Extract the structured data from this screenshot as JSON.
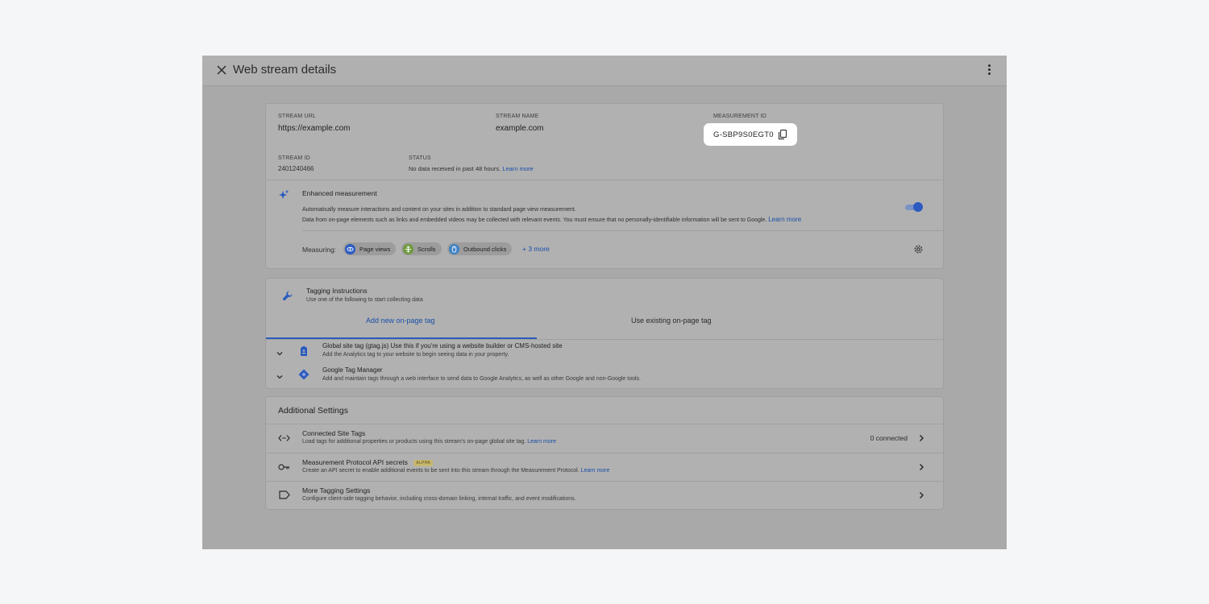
{
  "header": {
    "title": "Web stream details"
  },
  "details": {
    "stream_url_label": "STREAM URL",
    "stream_url": "https://example.com",
    "stream_name_label": "STREAM NAME",
    "stream_name": "example.com",
    "measurement_id_label": "MEASUREMENT ID",
    "measurement_id": "G-SBP9S0EGT0",
    "stream_id_label": "STREAM ID",
    "stream_id": "2401240466",
    "status_label": "STATUS",
    "status_text": "No data received in past 48 hours.",
    "status_link": "Learn more"
  },
  "enhanced": {
    "title": "Enhanced measurement",
    "desc_1": "Automatically measure interactions and content on your sites in addition to standard page view measurement.",
    "desc_2": "Data from on-page elements such as links and embedded videos may be collected with relevant events. You must ensure that no personally-identifiable information will be sent to Google.",
    "desc_link": "Learn more",
    "toggle_on": true,
    "measuring_label": "Measuring:",
    "chips": [
      "Page views",
      "Scrolls",
      "Outbound clicks"
    ],
    "more": "+ 3 more"
  },
  "tagging": {
    "title": "Tagging Instructions",
    "subtitle": "Use one of the following to start collecting data",
    "tab_new": "Add new on-page tag",
    "tab_existing": "Use existing on-page tag",
    "gtag_title": "Global site tag (gtag.js) Use this if you're using a website builder or CMS-hosted site",
    "gtag_desc": "Add the Analytics tag to your website to begin seeing data in your property.",
    "gtm_title": "Google Tag Manager",
    "gtm_desc": "Add and maintain tags through a web interface to send data to Google Analytics, as well as other Google and non-Google tools."
  },
  "additional": {
    "title": "Additional Settings",
    "connected_title": "Connected Site Tags",
    "connected_desc": "Load tags for additional properties or products using this stream's on-page global site tag.",
    "connected_link": "Learn more",
    "connected_count": "0 connected",
    "mp_title": "Measurement Protocol API secrets",
    "mp_badge": "ALPHA",
    "mp_desc": "Create an API secret to enable additional events to be sent into this stream through the Measurement Protocol.",
    "mp_link": "Learn more",
    "more_title": "More Tagging Settings",
    "more_desc": "Configure client-side tagging behavior, including cross-domain linking, internal traffic, and event modifications."
  },
  "colors": {
    "accent": "#2b5bc0",
    "overlay": "#a9a9a9",
    "highlight": "#ffffff"
  }
}
